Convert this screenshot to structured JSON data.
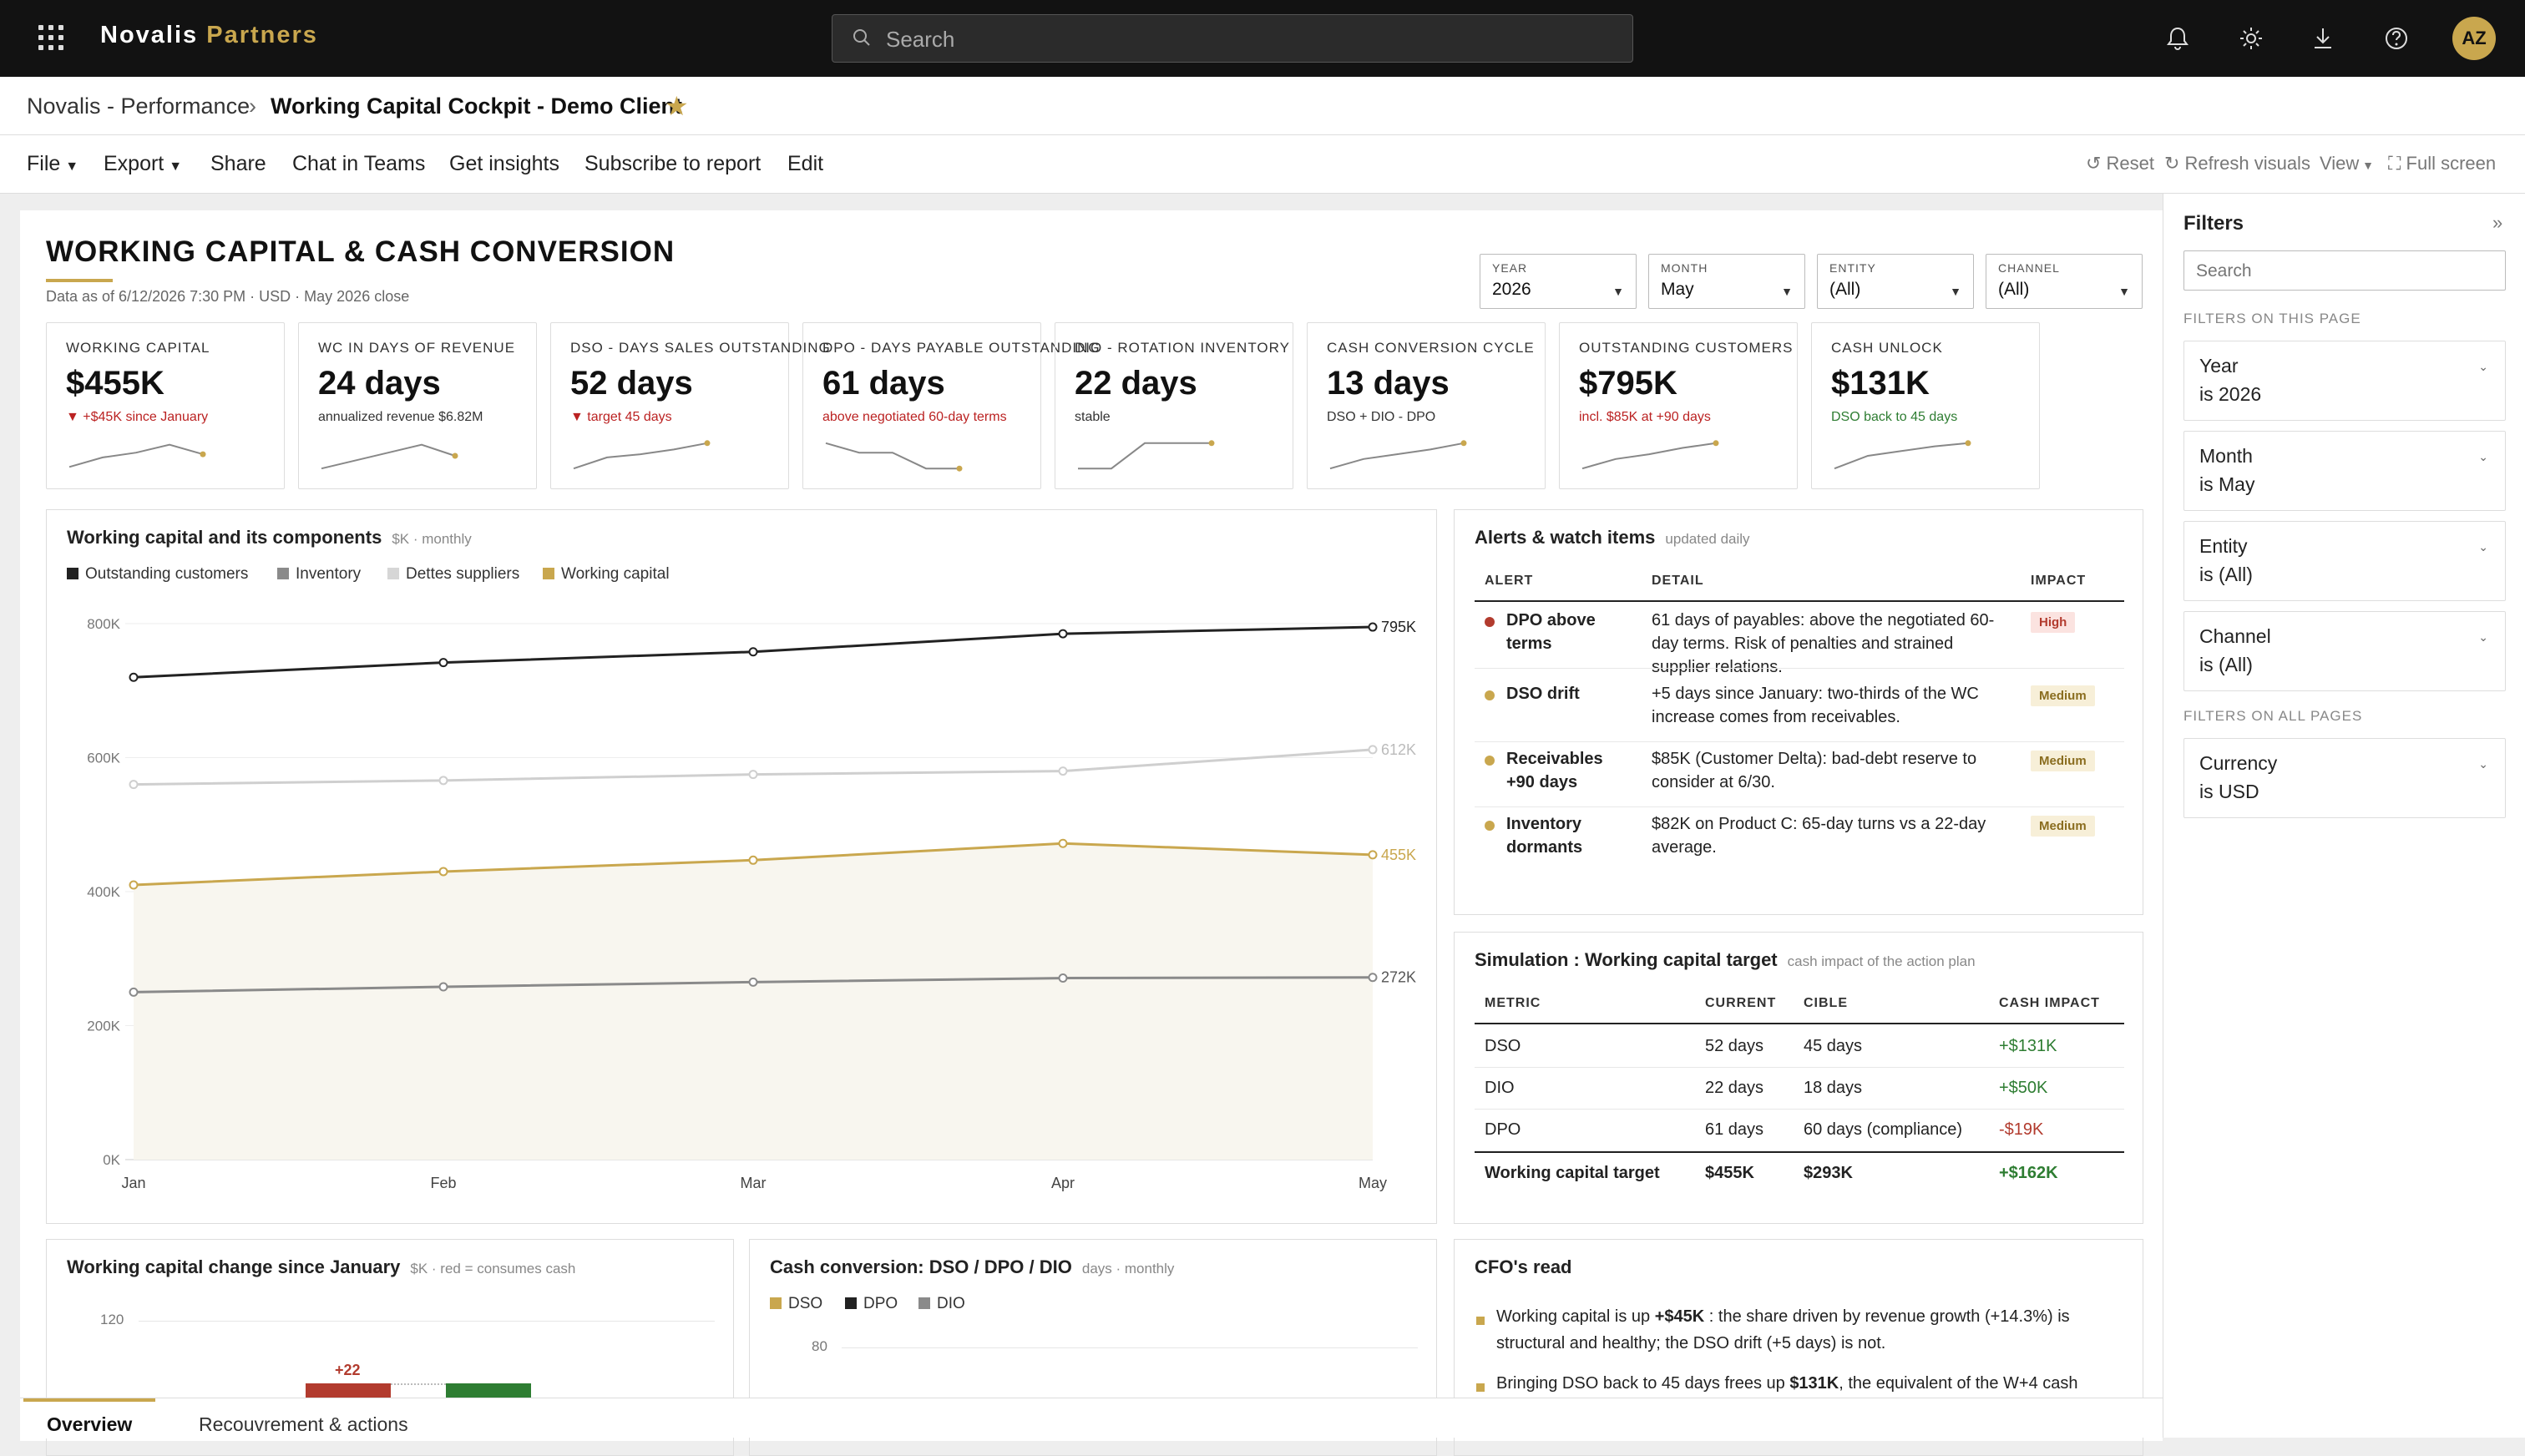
{
  "topbar": {
    "brand_main": "Novalis",
    "brand_accent": "Partners",
    "search_placeholder": "Search",
    "avatar": "AZ"
  },
  "breadcrumb": {
    "workspace": "Novalis - Performance",
    "sep": "›",
    "report": "Working Capital Cockpit - Demo Client"
  },
  "menu": {
    "file": "File",
    "export": "Export",
    "share": "Share",
    "chat": "Chat in Teams",
    "insights": "Get insights",
    "subscribe": "Subscribe to report",
    "edit": "Edit",
    "reset": "Reset",
    "refresh": "Refresh visuals",
    "view": "View",
    "fullscreen": "Full screen"
  },
  "report": {
    "title": "WORKING CAPITAL & CASH CONVERSION",
    "asof": "Data as of 6/12/2026 7:30 PM · USD · May 2026 close"
  },
  "slicers": [
    {
      "label": "YEAR",
      "value": "2026"
    },
    {
      "label": "MONTH",
      "value": "May"
    },
    {
      "label": "ENTITY",
      "value": "(All)"
    },
    {
      "label": "CHANNEL",
      "value": "(All)"
    }
  ],
  "kpis": [
    {
      "label": "WORKING CAPITAL",
      "value": "$455K",
      "sub": "▼ +$45K since January",
      "tone": "red",
      "spark": [
        0.15,
        0.45,
        0.6,
        0.85,
        0.55
      ]
    },
    {
      "label": "WC IN DAYS OF REVENUE",
      "value": "24 days",
      "sub": "annualized revenue $6.82M",
      "tone": "neutral",
      "spark": [
        0.1,
        0.35,
        0.6,
        0.85,
        0.5
      ]
    },
    {
      "label": "DSO - DAYS SALES OUTSTANDING",
      "value": "52 days",
      "sub": "▼ target 45 days",
      "tone": "red",
      "spark": [
        0.1,
        0.45,
        0.55,
        0.7,
        0.9
      ]
    },
    {
      "label": "DPO - DAYS PAYABLE OUTSTANDING",
      "value": "61 days",
      "sub": "above negotiated 60-day terms",
      "tone": "red",
      "spark": [
        0.9,
        0.6,
        0.6,
        0.1,
        0.1
      ]
    },
    {
      "label": "DIO - ROTATION INVENTORY",
      "value": "22 days",
      "sub": "stable",
      "tone": "neutral",
      "spark": [
        0.1,
        0.1,
        0.9,
        0.9,
        0.9
      ]
    },
    {
      "label": "CASH CONVERSION CYCLE",
      "value": "13 days",
      "sub": "DSO + DIO - DPO",
      "tone": "neutral",
      "spark": [
        0.1,
        0.4,
        0.55,
        0.7,
        0.9
      ]
    },
    {
      "label": "OUTSTANDING CUSTOMERS",
      "value": "$795K",
      "sub": "incl. $85K at +90 days",
      "tone": "red",
      "spark": [
        0.1,
        0.4,
        0.55,
        0.75,
        0.9
      ]
    },
    {
      "label": "CASH UNLOCK",
      "value": "$131K",
      "sub": "DSO back to 45 days",
      "tone": "green",
      "spark": [
        0.1,
        0.5,
        0.65,
        0.8,
        0.9
      ]
    }
  ],
  "wc_chart": {
    "title": "Working capital and its components",
    "subtitle": "$K · monthly",
    "legend": [
      "Outstanding customers",
      "Inventory",
      "Dettes suppliers",
      "Working capital"
    ],
    "chart_data": {
      "type": "line",
      "x": [
        "Jan",
        "Feb",
        "Mar",
        "Apr",
        "May"
      ],
      "series": [
        {
          "name": "Outstanding customers",
          "values": [
            720,
            742,
            758,
            785,
            795
          ],
          "color": "#222222"
        },
        {
          "name": "Inventory",
          "values": [
            250,
            258,
            265,
            271,
            272
          ],
          "color": "#8a8a8a"
        },
        {
          "name": "Dettes suppliers",
          "values": [
            560,
            566,
            575,
            580,
            612
          ],
          "color": "#cfcfcf"
        },
        {
          "name": "Working capital",
          "values": [
            410,
            430,
            447,
            472,
            455
          ],
          "color": "#c9a74e"
        }
      ],
      "end_labels": [
        "795K",
        "272K",
        "612K",
        "455K"
      ],
      "yticks": [
        "0K",
        "200K",
        "400K",
        "600K",
        "800K"
      ],
      "ylim": [
        0,
        820
      ]
    }
  },
  "alerts": {
    "title": "Alerts & watch items",
    "subtitle": "updated daily",
    "headers": [
      "ALERT",
      "DETAIL",
      "IMPACT"
    ],
    "rows": [
      {
        "a1": "DPO above",
        "a2": "terms",
        "d1": "61 days of payables: above the negotiated 60-",
        "d2": "day terms. Risk of penalties and strained",
        "d3": "supplier relations.",
        "impact": "High",
        "color": "#b23b2e"
      },
      {
        "a1": "DSO drift",
        "a2": "",
        "d1": "+5 days since January: two-thirds of the WC",
        "d2": "increase comes from receivables.",
        "d3": "",
        "impact": "Medium",
        "color": "#c9a74e"
      },
      {
        "a1": "Receivables",
        "a2": "+90 days",
        "d1": "$85K (Customer Delta): bad-debt reserve to",
        "d2": "consider at 6/30.",
        "d3": "",
        "impact": "Medium",
        "color": "#c9a74e"
      },
      {
        "a1": "Inventory",
        "a2": "dormants",
        "d1": "$82K on Product C: 65-day turns vs a 22-day",
        "d2": "average.",
        "d3": "",
        "impact": "Medium",
        "color": "#c9a74e"
      }
    ]
  },
  "sim": {
    "title": "Simulation : Working capital target",
    "subtitle": "cash impact of the action plan",
    "headers": [
      "METRIC",
      "CURRENT",
      "CIBLE",
      "CASH IMPACT"
    ],
    "rows": [
      {
        "m": "DSO",
        "c": "52 days",
        "t": "45 days",
        "i": "+$131K"
      },
      {
        "m": "DIO",
        "c": "22 days",
        "t": "18 days",
        "i": "+$50K"
      },
      {
        "m": "DPO",
        "c": "61 days",
        "t": "60 days (compliance)",
        "i": "-$19K"
      }
    ],
    "total": {
      "m": "Working capital target",
      "c": "$455K",
      "t": "$293K",
      "i": "+$162K"
    }
  },
  "wc_change": {
    "title": "Working capital change since January",
    "subtitle": "$K · red = consumes cash",
    "ytick": "120",
    "bar_label": "+22"
  },
  "cash_conv": {
    "title": "Cash conversion: DSO / DPO / DIO",
    "subtitle": "days · monthly",
    "legend": [
      "DSO",
      "DPO",
      "DIO"
    ],
    "ytick": "80"
  },
  "cfo": {
    "title": "CFO's read",
    "p1a": "Working capital is up ",
    "p1b": "+$45K",
    "p1c": " : the share driven by revenue growth (+14.3%) is",
    "p1d": "structural and healthy; the DSO drift (+5 days) is not.",
    "p2a": "Bringing DSO back to 45 days frees up ",
    "p2b": "$131K",
    "p2c": ", the equivalent of the W+4 cash"
  },
  "filters": {
    "title": "Filters",
    "collapse": "»",
    "search_placeholder": "Search",
    "on_page": "FILTERS ON THIS PAGE",
    "on_all": "FILTERS ON ALL PAGES",
    "cards": [
      {
        "a": "Year",
        "b": "is 2026"
      },
      {
        "a": "Month",
        "b": "is May"
      },
      {
        "a": "Entity",
        "b": "is (All)"
      },
      {
        "a": "Channel",
        "b": "is (All)"
      }
    ],
    "all_cards": [
      {
        "a": "Currency",
        "b": "is USD"
      }
    ]
  },
  "tabs": [
    "Overview",
    "Recouvrement & actions"
  ]
}
